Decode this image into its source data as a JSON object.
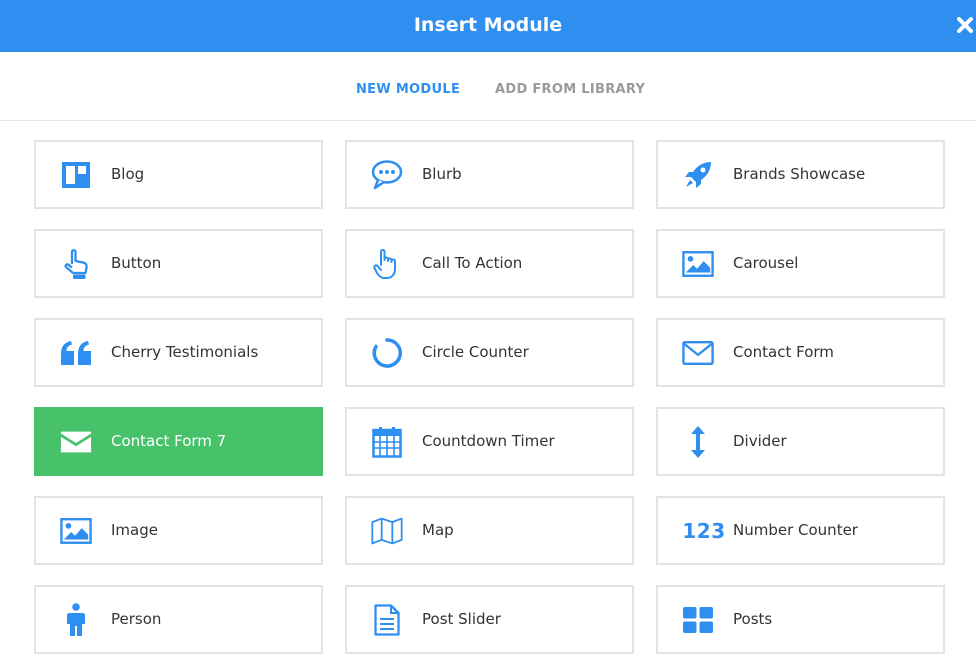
{
  "header": {
    "title": "Insert Module"
  },
  "tabs": [
    {
      "label": "NEW MODULE"
    },
    {
      "label": "ADD FROM LIBRARY"
    }
  ],
  "modules": [
    {
      "label": "Blog",
      "icon": "blog-layout-icon"
    },
    {
      "label": "Blurb",
      "icon": "speech-bubble-icon"
    },
    {
      "label": "Brands Showcase",
      "icon": "rocket-icon"
    },
    {
      "label": "Button",
      "icon": "pointing-hand-icon"
    },
    {
      "label": "Call To Action",
      "icon": "hand-outline-icon"
    },
    {
      "label": "Carousel",
      "icon": "picture-icon"
    },
    {
      "label": "Cherry Testimonials",
      "icon": "quote-icon"
    },
    {
      "label": "Circle Counter",
      "icon": "circle-progress-icon"
    },
    {
      "label": "Contact Form",
      "icon": "envelope-outline-icon"
    },
    {
      "label": "Contact Form 7",
      "icon": "envelope-icon",
      "selected": true
    },
    {
      "label": "Countdown Timer",
      "icon": "calendar-icon"
    },
    {
      "label": "Divider",
      "icon": "vertical-arrows-icon"
    },
    {
      "label": "Image",
      "icon": "picture-icon"
    },
    {
      "label": "Map",
      "icon": "map-icon"
    },
    {
      "label": "Number Counter",
      "icon": "number-icon",
      "icon_text": "123"
    },
    {
      "label": "Person",
      "icon": "person-icon"
    },
    {
      "label": "Post Slider",
      "icon": "document-icon"
    },
    {
      "label": "Posts",
      "icon": "grid-icon"
    }
  ],
  "colors": {
    "accent": "#2f8ff0",
    "selected": "#47c16a",
    "border": "#e3e3e3",
    "muted_tab": "#9a9a9a"
  }
}
